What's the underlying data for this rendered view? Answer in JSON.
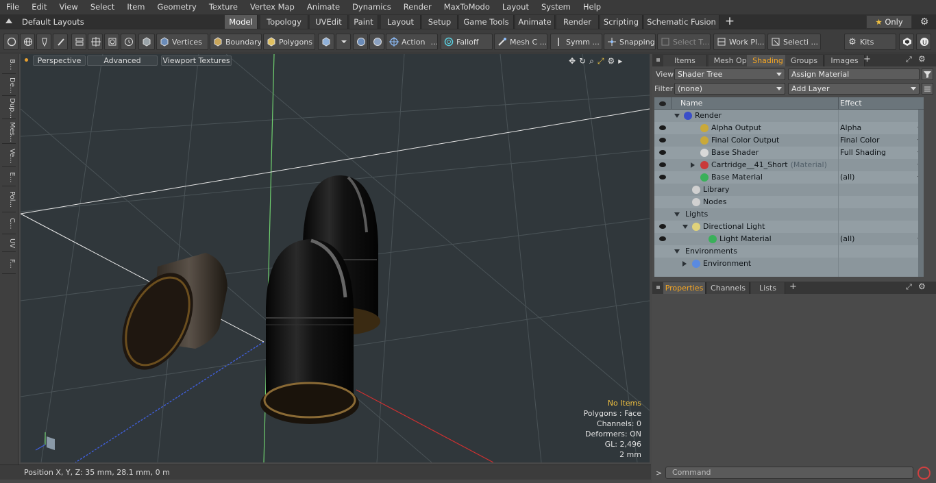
{
  "menu": [
    "File",
    "Edit",
    "View",
    "Select",
    "Item",
    "Geometry",
    "Texture",
    "Vertex Map",
    "Animate",
    "Dynamics",
    "Render",
    "MaxToModo",
    "Layout",
    "System",
    "Help"
  ],
  "layout_selector": "Default Layouts",
  "layout_tabs": [
    {
      "label": "Model",
      "active": true
    },
    {
      "label": "Topology",
      "active": false
    },
    {
      "label": "UVEdit",
      "active": false
    },
    {
      "label": "Paint",
      "active": false
    },
    {
      "label": "Layout",
      "active": false
    },
    {
      "label": "Setup",
      "active": false
    },
    {
      "label": "Game Tools",
      "active": false
    },
    {
      "label": "Animate",
      "active": false
    },
    {
      "label": "Render",
      "active": false
    },
    {
      "label": "Scripting",
      "active": false
    },
    {
      "label": "Schematic Fusion",
      "active": false
    }
  ],
  "only_label": "Only",
  "toolbar": {
    "vertices": "Vertices",
    "boundary": "Boundary",
    "polygons": "Polygons",
    "action": "Action",
    "falloff": "Falloff",
    "mesh": "Mesh C ...",
    "symm": "Symm ...",
    "snapping": "Snapping",
    "select_t": "Select T...",
    "work_plane": "Work Pl...",
    "selecti": "Selecti ...",
    "kits": "Kits"
  },
  "left_tools": [
    "B...",
    "De...",
    "Dup...",
    "Mes...",
    "Ve...",
    "E...",
    "Pol...",
    "C...",
    "UV",
    "F..."
  ],
  "viewport": {
    "perspective": "Perspective",
    "advanced": "Advanced",
    "textures": "Viewport Textures"
  },
  "stats": {
    "items": "No Items",
    "polygons": "Polygons : Face",
    "channels": "Channels: 0",
    "deformers": "Deformers: ON",
    "gl": "GL: 2,496",
    "scale": "2 mm"
  },
  "status": "Position X, Y, Z:   35 mm, 28.1 mm, 0 m",
  "panel_tabs": [
    {
      "label": "Items",
      "active": false
    },
    {
      "label": "Mesh Ops",
      "active": false
    },
    {
      "label": "Shading",
      "active": true
    },
    {
      "label": "Groups",
      "active": false
    },
    {
      "label": "Images",
      "active": false
    }
  ],
  "view_label": "View",
  "view_value": "Shader Tree",
  "assign_material": "Assign Material",
  "filter_label": "Filter",
  "filter_value": "(none)",
  "add_layer": "Add Layer",
  "tree_headers": {
    "name": "Name",
    "effect": "Effect"
  },
  "tree": [
    {
      "name": "Render",
      "sub": "",
      "effect": "",
      "eye": false,
      "indent": 0,
      "tri": "down",
      "icon": "#3a4ec9",
      "dd": false
    },
    {
      "name": "Alpha Output",
      "sub": "",
      "effect": "Alpha",
      "eye": true,
      "indent": 2,
      "tri": "",
      "icon": "#c9a93a",
      "dd": true
    },
    {
      "name": "Final Color Output",
      "sub": "",
      "effect": "Final Color",
      "eye": true,
      "indent": 2,
      "tri": "",
      "icon": "#c9a93a",
      "dd": true
    },
    {
      "name": "Base Shader",
      "sub": "",
      "effect": "Full Shading",
      "eye": true,
      "indent": 2,
      "tri": "",
      "icon": "#d8d8d8",
      "dd": true
    },
    {
      "name": "Cartridge__41_Short",
      "sub": "(Material)",
      "effect": "",
      "eye": true,
      "indent": 2,
      "tri": "right",
      "icon": "#c93a3a",
      "dd": true
    },
    {
      "name": "Base Material",
      "sub": "",
      "effect": "(all)",
      "eye": true,
      "indent": 2,
      "tri": "",
      "icon": "#3ab05a",
      "dd": true
    },
    {
      "name": "Library",
      "sub": "",
      "effect": "",
      "eye": false,
      "indent": 1,
      "tri": "",
      "icon": "#d0d0d0",
      "dd": false
    },
    {
      "name": "Nodes",
      "sub": "",
      "effect": "",
      "eye": false,
      "indent": 1,
      "tri": "",
      "icon": "#d0d0d0",
      "dd": false
    },
    {
      "name": "Lights",
      "sub": "",
      "effect": "",
      "eye": false,
      "indent": 0,
      "tri": "down",
      "icon": "",
      "dd": false
    },
    {
      "name": "Directional Light",
      "sub": "",
      "effect": "",
      "eye": true,
      "indent": 1,
      "tri": "down",
      "icon": "#e0d27a",
      "dd": false
    },
    {
      "name": "Light Material",
      "sub": "",
      "effect": "(all)",
      "eye": true,
      "indent": 3,
      "tri": "",
      "icon": "#3ab05a",
      "dd": true
    },
    {
      "name": "Environments",
      "sub": "",
      "effect": "",
      "eye": false,
      "indent": 0,
      "tri": "down",
      "icon": "",
      "dd": false
    },
    {
      "name": "Environment",
      "sub": "",
      "effect": "",
      "eye": false,
      "indent": 1,
      "tri": "right",
      "icon": "#5a8ae0",
      "dd": false
    }
  ],
  "props_tabs": [
    {
      "label": "Properties",
      "active": true
    },
    {
      "label": "Channels",
      "active": false
    },
    {
      "label": "Lists",
      "active": false
    }
  ],
  "command_placeholder": "Command"
}
